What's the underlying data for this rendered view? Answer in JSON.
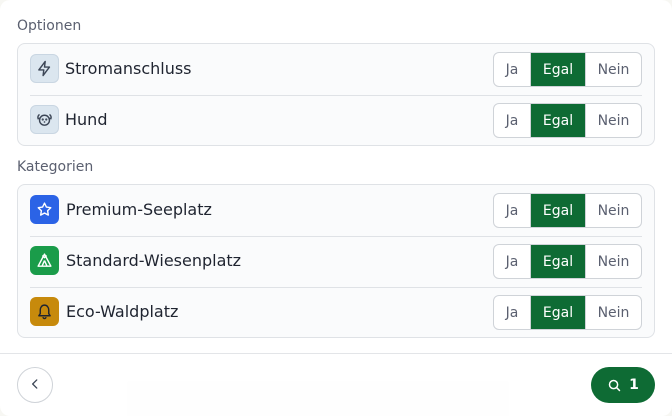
{
  "options": {
    "heading": "Optionen",
    "items": [
      {
        "label": "Stromanschluss",
        "icon": "lightning-bolt-icon",
        "selected": "Egal"
      },
      {
        "label": "Hund",
        "icon": "dog-icon",
        "selected": "Egal"
      }
    ]
  },
  "categories": {
    "heading": "Kategorien",
    "items": [
      {
        "label": "Premium-Seeplatz",
        "icon": "star-icon",
        "icon_color": "#2b63e6",
        "selected": "Egal"
      },
      {
        "label": "Standard-Wiesenplatz",
        "icon": "tent-icon",
        "icon_color": "#1a9c4a",
        "selected": "Egal"
      },
      {
        "label": "Eco-Waldplatz",
        "icon": "bell-icon",
        "icon_color": "#c78a0c",
        "selected": "Egal"
      }
    ]
  },
  "toggle": {
    "yes": "Ja",
    "any": "Egal",
    "no": "Nein"
  },
  "footer": {
    "result_count": "1"
  },
  "colors": {
    "accent": "#0e6b34"
  }
}
